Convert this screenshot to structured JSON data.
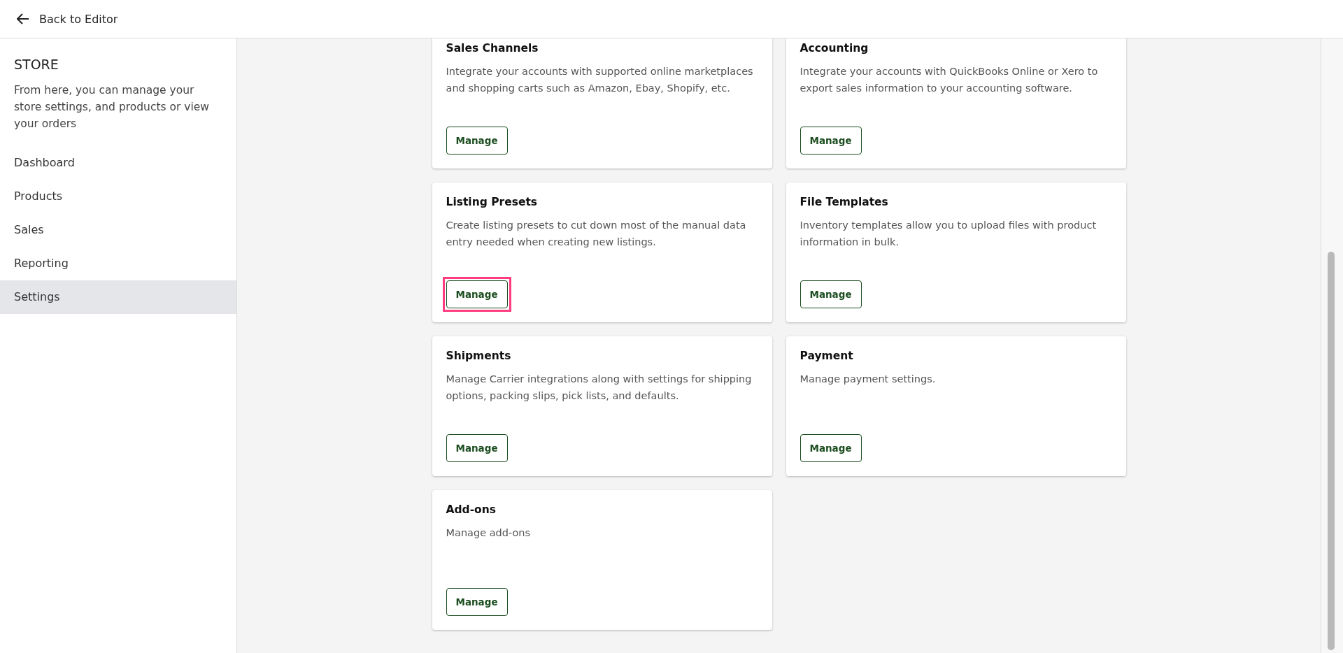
{
  "header": {
    "back_link": "Back to Editor"
  },
  "sidebar": {
    "title": "STORE",
    "description": "From here, you can manage your store settings, and products or view your orders",
    "items": [
      {
        "label": "Dashboard",
        "selected": false
      },
      {
        "label": "Products",
        "selected": false
      },
      {
        "label": "Sales",
        "selected": false
      },
      {
        "label": "Reporting",
        "selected": false
      },
      {
        "label": "Settings",
        "selected": true
      }
    ]
  },
  "cards": [
    {
      "title": "Sales Channels",
      "description": "Integrate your accounts with supported online marketplaces and shopping carts such as Amazon, Ebay, Shopify, etc.",
      "button": "Manage",
      "highlighted": false
    },
    {
      "title": "Accounting",
      "description": "Integrate your accounts with QuickBooks Online or Xero to export sales information to your accounting software.",
      "button": "Manage",
      "highlighted": false
    },
    {
      "title": "Listing Presets",
      "description": "Create listing presets to cut down most of the manual data entry needed when creating new listings.",
      "button": "Manage",
      "highlighted": true
    },
    {
      "title": "File Templates",
      "description": "Inventory templates allow you to upload files with product information in bulk.",
      "button": "Manage",
      "highlighted": false
    },
    {
      "title": "Shipments",
      "description": "Manage Carrier integrations along with settings for shipping options, packing slips, pick lists, and defaults.",
      "button": "Manage",
      "highlighted": false
    },
    {
      "title": "Payment",
      "description": "Manage payment settings.",
      "button": "Manage",
      "highlighted": false
    },
    {
      "title": "Add-ons",
      "description": "Manage add-ons",
      "button": "Manage",
      "highlighted": false
    }
  ]
}
